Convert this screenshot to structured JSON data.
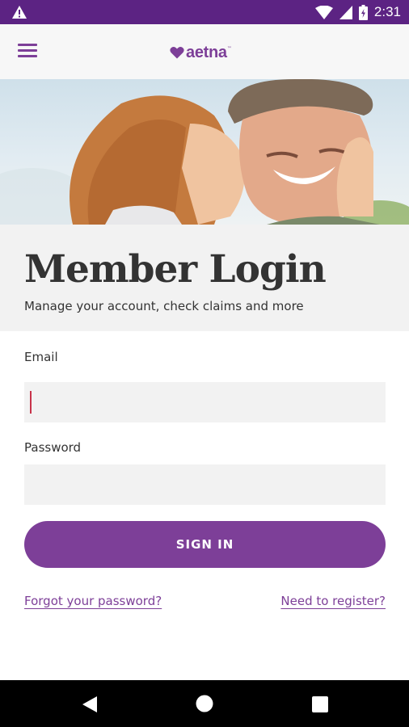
{
  "status_bar": {
    "time": "2:31",
    "icons": [
      "warning-icon",
      "wifi-icon",
      "signal-icon",
      "battery-icon"
    ],
    "color": "#5c2383"
  },
  "app_bar": {
    "menu_icon": "hamburger-menu-icon",
    "brand": "aetna",
    "brand_mark": "™",
    "accent_color": "#7d3f98"
  },
  "hero": {
    "image": "couple-kiss-photo"
  },
  "login": {
    "title": "Member Login",
    "subtitle": "Manage your account, check claims and more",
    "email_label": "Email",
    "email_value": "",
    "password_label": "Password",
    "password_value": "",
    "sign_in_label": "SIGN IN",
    "forgot_password_link": "Forgot your password?",
    "register_link": "Need to register?"
  },
  "nav_bar": {
    "buttons": [
      "back-icon",
      "home-icon",
      "recents-icon"
    ]
  }
}
